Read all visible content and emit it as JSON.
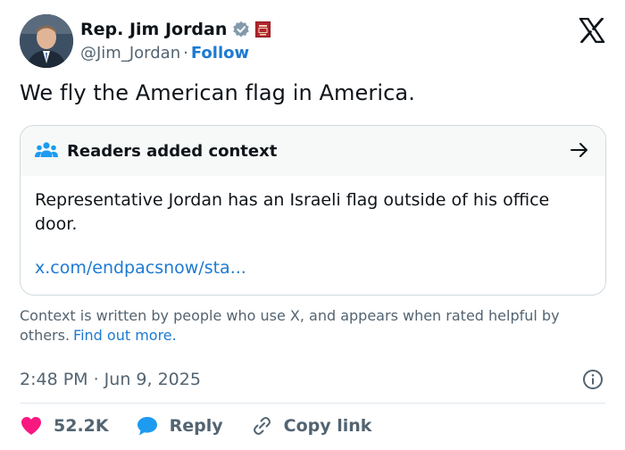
{
  "author": {
    "display_name": "Rep. Jim Jordan",
    "handle": "@Jim_Jordan",
    "separator": "·",
    "follow_label": "Follow"
  },
  "tweet": {
    "text": "We fly the American flag in America."
  },
  "context": {
    "title": "Readers added context",
    "body": "Representative Jordan has an Israeli flag outside of his office door.",
    "link": "x.com/endpacsnow/sta..."
  },
  "footnote": {
    "text": "Context is written by people who use X, and appears when rated helpful by others.",
    "link": "Find out more."
  },
  "timestamp": "2:48 PM · Jun 9, 2025",
  "actions": {
    "likes": "52.2K",
    "reply_label": "Reply",
    "copy_label": "Copy link"
  },
  "colors": {
    "link_blue": "#1d7ad2",
    "heart": "#f91880",
    "reply_bubble": "#1d9bf0",
    "context_icon": "#1d9bf0"
  },
  "icons": [
    "verified-badge-icon",
    "government-affiliation-icon",
    "x-logo-icon",
    "people-icon",
    "arrow-right-icon",
    "info-icon",
    "heart-icon",
    "reply-bubble-icon",
    "link-icon"
  ]
}
